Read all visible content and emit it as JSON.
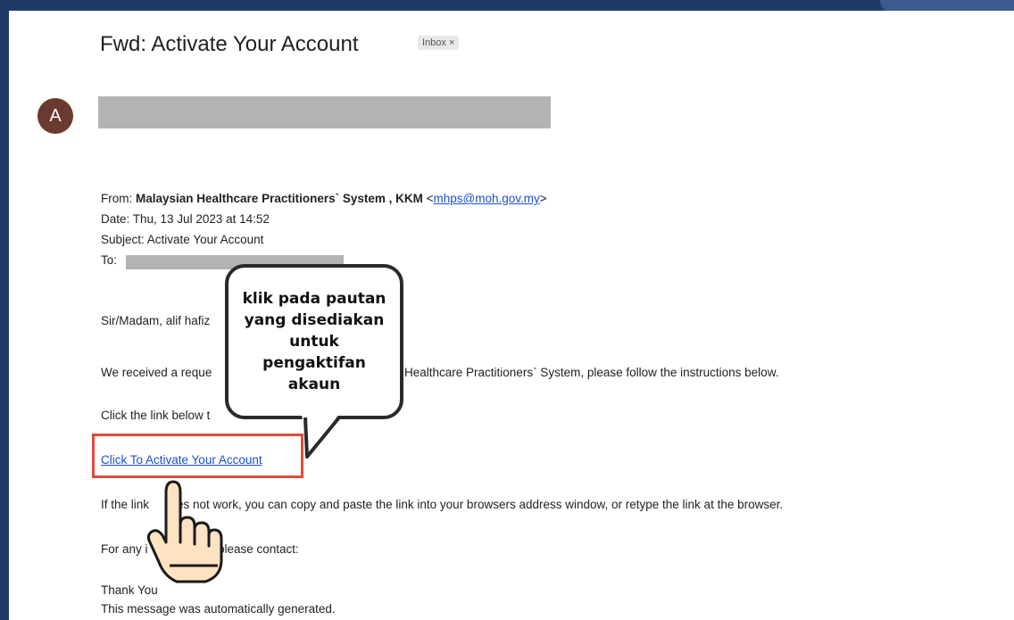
{
  "email": {
    "subject": "Fwd: Activate Your Account",
    "label_chip": "Inbox ×",
    "sender_initial": "A",
    "forwarded": {
      "from_prefix": "From: ",
      "from_name": "Malaysian Healthcare Practitioners` System , KKM",
      "from_email": "mhps@moh.gov.my",
      "date": "Date: Thu, 13 Jul 2023 at 14:52",
      "subject": "Subject: Activate Your Account",
      "to_prefix": "To:"
    },
    "body": {
      "greeting": "Sir/Madam, alif hafiz",
      "received": "We received a reque",
      "received_tail": "Healthcare Practitioners` System, please follow the instructions below.",
      "click_below": "Click the link below t",
      "activate_link": "Click To Activate Your Account",
      "link_fail_a": "If the link",
      "link_fail_b": "es not work, you can copy and paste the link into your browsers address window, or retype the link at the browser.",
      "contact_a": "For any i",
      "contact_b": "please contact:",
      "thanks": "Thank You",
      "auto": "This message was automatically generated."
    }
  },
  "callout": {
    "text": "klik pada pautan yang disediakan untuk pengaktifan akaun"
  },
  "colors": {
    "background": "#1f3a66",
    "highlight_box": "#e04c3c",
    "link": "#1a4fd6",
    "avatar": "#6b3a2e"
  },
  "icons": [
    "pointing-hand-icon",
    "close-icon"
  ]
}
